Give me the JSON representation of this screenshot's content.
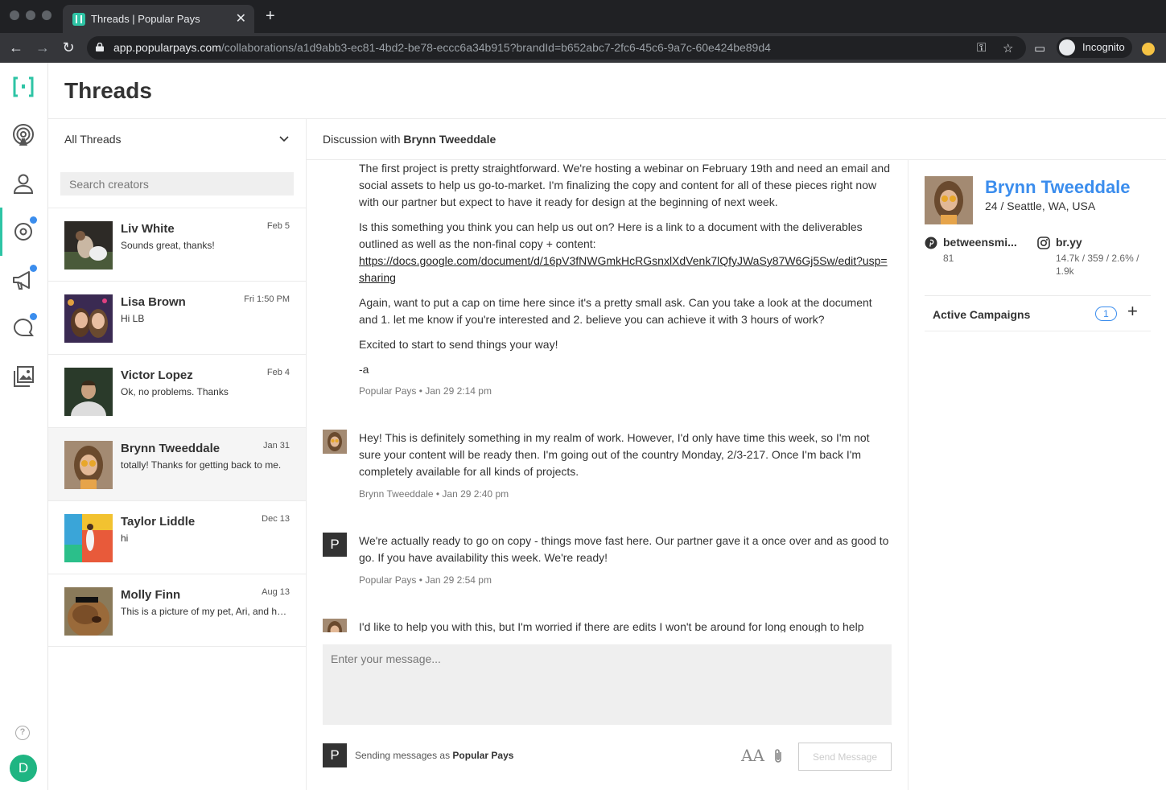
{
  "browser": {
    "tab_title": "Threads | Popular Pays",
    "url_host": "app.popularpays.com",
    "url_path": "/collaborations/a1d9abb3-ec81-4bd2-be78-eccc6a34b915?brandId=b652abc7-2fc6-45c6-9a7c-60e424be89d4",
    "incognito_label": "Incognito"
  },
  "page": {
    "title": "Threads"
  },
  "user": {
    "initial": "D"
  },
  "threads": {
    "filter_label": "All Threads",
    "search_placeholder": "Search creators",
    "items": [
      {
        "name": "Liv White",
        "date": "Feb 5",
        "preview": "Sounds great, thanks!"
      },
      {
        "name": "Lisa Brown",
        "date": "Fri 1:50 PM",
        "preview": "Hi LB"
      },
      {
        "name": "Victor Lopez",
        "date": "Feb 4",
        "preview": "Ok, no problems. Thanks"
      },
      {
        "name": "Brynn Tweeddale",
        "date": "Jan 31",
        "preview": "totally! Thanks for getting back to me."
      },
      {
        "name": "Taylor Liddle",
        "date": "Dec 13",
        "preview": "hi"
      },
      {
        "name": "Molly Finn",
        "date": "Aug 13",
        "preview": "This is a picture of my pet, Ari, and he is very cute"
      }
    ]
  },
  "discussion": {
    "title_prefix": "Discussion with",
    "title_name": "Brynn Tweeddale",
    "messages": [
      {
        "paragraphs": [
          "The first project is pretty straightforward. We're hosting a webinar on February 19th and need an email and social assets to help us go-to-market. I'm finalizing the copy and content for all of these pieces right now with our partner but expect to have it ready for design at the beginning of next week.",
          "Is this something you think you can help us out on? Here is a link to a document with the deliverables outlined as well as the non-final copy + content:",
          "Again, want to put a cap on time here since it's a pretty small ask. Can you take a look at the document and 1. let me know if you're interested and 2. believe you can achieve it with 3 hours of work?",
          "Excited to start to send things your way!",
          "-a"
        ],
        "link": "https://docs.google.com/document/d/16pV3fNWGmkHcRGsnxlXdVenk7lQfyJWaSy87W6Gj5Sw/edit?usp=sharing",
        "sender": "Popular Pays",
        "time": "Jan 29 2:14 pm"
      },
      {
        "text": "Hey! This is definitely something in my realm of work. However, I'd only have time this week, so I'm not sure your content will be ready then. I'm going out of the country Monday, 2/3-217. Once I'm back I'm completely available for all kinds of projects.",
        "sender": "Brynn Tweeddale",
        "time": "Jan 29 2:40 pm"
      },
      {
        "avatar_initial": "P",
        "text": "We're actually ready to go on copy - things move fast here. Our partner gave it a once over and as good to go. If you have availability this week. We're ready!",
        "sender": "Popular Pays",
        "time": "Jan 29 2:54 pm"
      },
      {
        "text": "I'd like to help you with this, but I'm worried if there are edits I won't be around for long enough to help"
      }
    ],
    "composer_placeholder": "Enter your message...",
    "sending_as_prefix": "Sending messages as",
    "sending_as_name": "Popular Pays",
    "sender_initial": "P",
    "send_button": "Send Message"
  },
  "profile": {
    "name": "Brynn Tweeddale",
    "location": "24 / Seattle, WA, USA",
    "pinterest": {
      "handle": "betweensmi...",
      "stats": "81"
    },
    "instagram": {
      "handle": "br.yy",
      "stats": "14.7k / 359 / 2.6% / 1.9k"
    },
    "active_campaigns_label": "Active Campaigns",
    "active_campaigns_count": "1"
  },
  "colors": {
    "accent_green": "#2ec4a5",
    "link_blue": "#3b8ded",
    "badge_blue": "#3b8ded"
  }
}
